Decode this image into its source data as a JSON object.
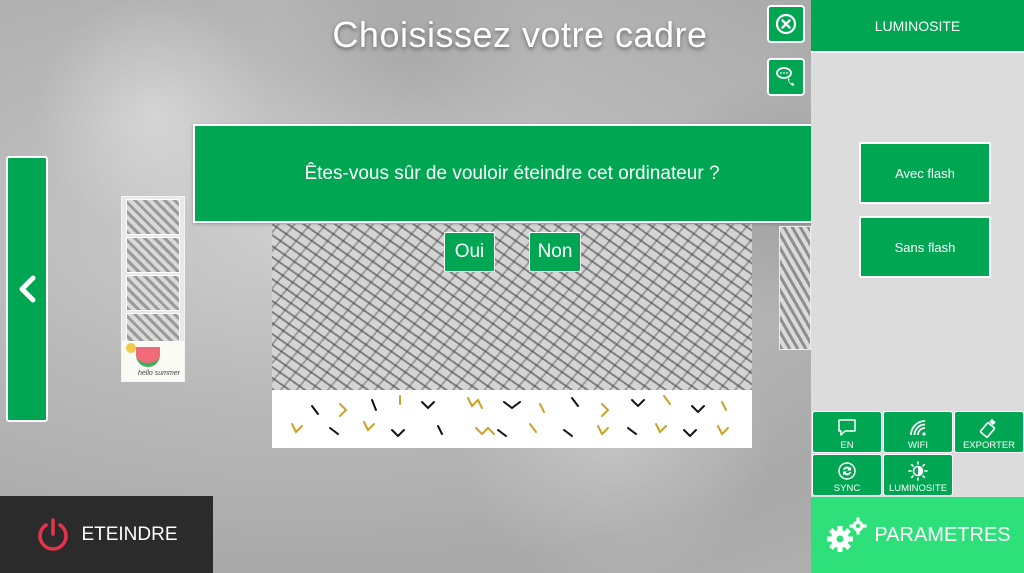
{
  "title": "Choisissez votre cadre",
  "dialog": {
    "message": "Êtes-vous sûr de vouloir éteindre cet ordinateur ?",
    "yes_label": "Oui",
    "no_label": "Non"
  },
  "preview": {
    "thumb_caption": "hello summer"
  },
  "side": {
    "header": "LUMINOSITE",
    "flash_on_label": "Avec flash",
    "flash_off_label": "Sans flash"
  },
  "tiles": {
    "language": "EN",
    "wifi": "WIFI",
    "export": "EXPORTER",
    "sync": "SYNC",
    "brightness": "LUMINOSITE"
  },
  "parameters_label": "PARAMETRES",
  "shutdown_label": "ETEINDRE",
  "colors": {
    "accent_green": "#00a651",
    "params_green": "#2ee07a",
    "shutdown_bg": "#2b2b2b",
    "power_red": "#e8334a"
  },
  "icons": {
    "nav_left": "chevron-left-icon",
    "close": "close-circle-icon",
    "support": "chat-phone-icon",
    "language": "speech-bubble-icon",
    "wifi": "wifi-icon",
    "export": "usb-drive-icon",
    "sync": "sync-icon",
    "brightness": "brightness-icon",
    "parameters": "gears-icon",
    "shutdown": "power-icon"
  }
}
